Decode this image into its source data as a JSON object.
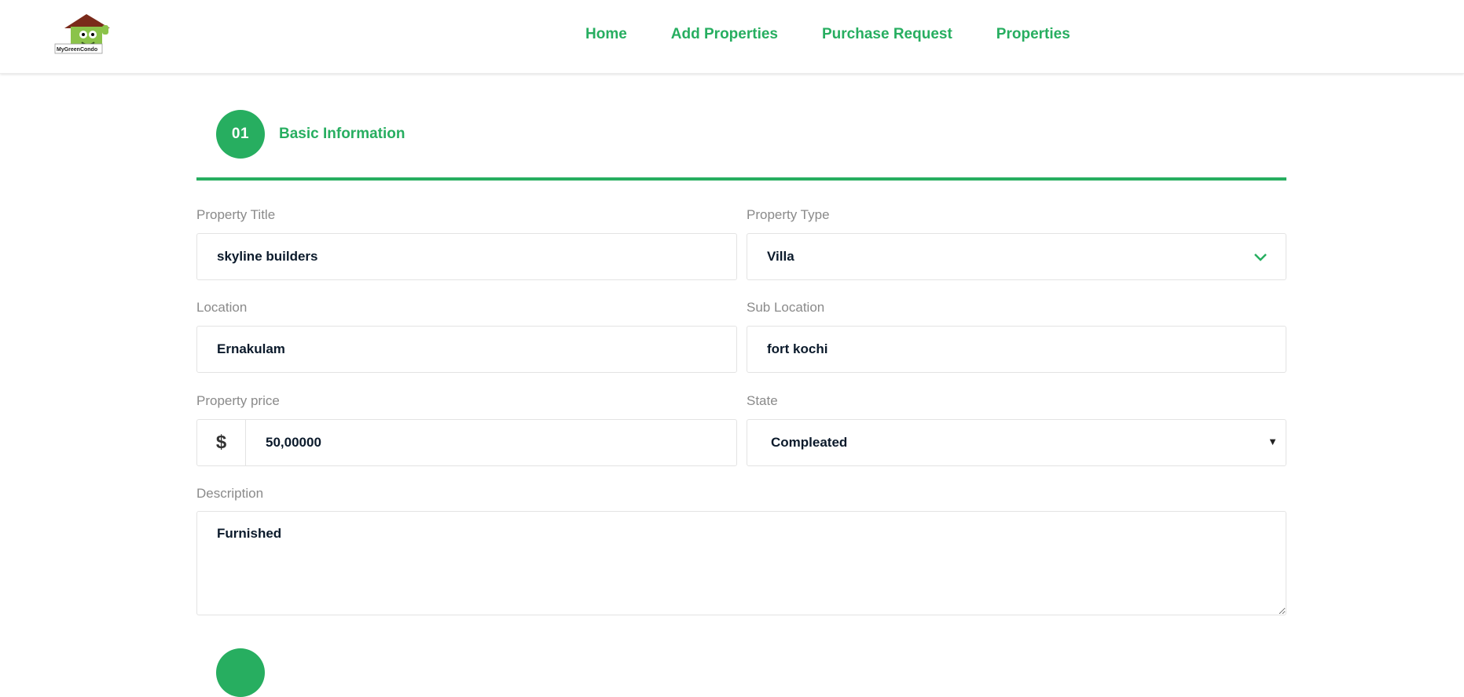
{
  "brand": {
    "logo_text": "MyGreenCondo"
  },
  "nav": [
    {
      "label": "Home"
    },
    {
      "label": "Add Properties"
    },
    {
      "label": "Purchase Request"
    },
    {
      "label": "Properties"
    }
  ],
  "step": {
    "number": "01",
    "title": "Basic Information"
  },
  "form": {
    "property_title": {
      "label": "Property Title",
      "value": "skyline builders"
    },
    "property_type": {
      "label": "Property Type",
      "value": "Villa"
    },
    "location": {
      "label": "Location",
      "value": "Ernakulam"
    },
    "sub_location": {
      "label": "Sub Location",
      "value": "fort kochi"
    },
    "property_price": {
      "label": "Property price",
      "currency_symbol": "$",
      "value": "50,00000"
    },
    "state": {
      "label": "State",
      "value": "Compleated"
    },
    "description": {
      "label": "Description",
      "value": "Furnished"
    }
  },
  "colors": {
    "accent": "#27ae60"
  }
}
